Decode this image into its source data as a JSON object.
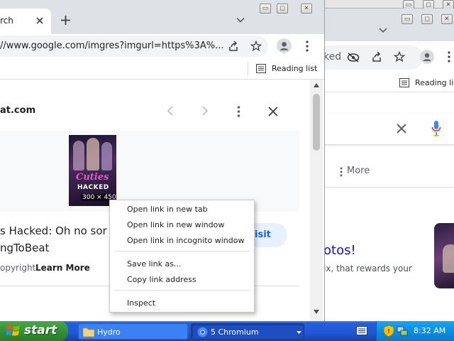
{
  "back_window": {
    "toolbar_text": "ked",
    "bookmarks_label": "Reading list",
    "more_label": "More",
    "heading": "otos!",
    "body_text": "ix, that rewards your"
  },
  "front_window": {
    "tab_title": "rch",
    "address": "//www.google.com/imgres?imgurl=https%3A%...",
    "bookmarks_label": "Reading list",
    "site_name": "at.com",
    "thumbnail": {
      "title_line1": "Cuties",
      "title_line2": "HACKED",
      "dimensions": "300 × 450"
    },
    "result_title_line1": "s Hacked: Oh no sor",
    "result_title_line2": "ngToBeat",
    "copyright_text": "opyright.",
    "learn_more": "Learn More",
    "visit_label": "isit"
  },
  "context_menu": {
    "items": [
      "Open link in new tab",
      "Open link in new window",
      "Open link in incognito window",
      "Save link as...",
      "Copy link address",
      "Inspect"
    ]
  },
  "taskbar": {
    "start_label": "start",
    "tasks": [
      {
        "label": "Hydro"
      },
      {
        "label": "5 Chromium"
      }
    ],
    "clock": "8:32 AM"
  },
  "colors": {
    "taskbar": "#245edb",
    "start": "#3c9a3c",
    "tray": "#0e8ee2",
    "link_blue": "#1a73e8",
    "mic_red": "#ea4335",
    "visit_button_bg": "#e8f0fe",
    "thumbnail_pink": "#e05cc6"
  }
}
